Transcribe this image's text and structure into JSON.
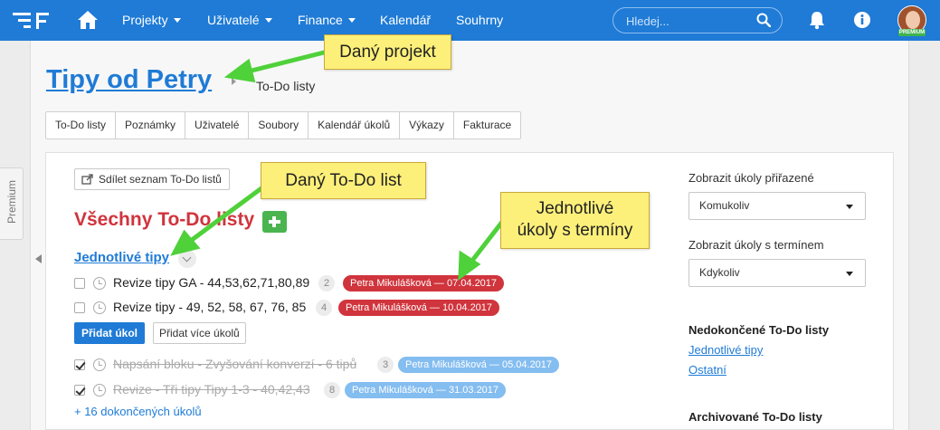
{
  "nav": {
    "items": [
      "Projekty",
      "Uživatelé",
      "Finance",
      "Kalendář",
      "Souhrny"
    ],
    "search_placeholder": "Hledej...",
    "avatar_badge": "PREMIUM"
  },
  "sidebar_tab": "Premium",
  "project": {
    "title": "Tipy od Petry",
    "breadcrumb": "To-Do listy"
  },
  "tabs": [
    "To-Do listy",
    "Poznámky",
    "Uživatelé",
    "Soubory",
    "Kalendář úkolů",
    "Výkazy",
    "Fakturace"
  ],
  "share_button": "Sdílet seznam To-Do listů",
  "section_title": "Všechny To-Do listy",
  "todo_list": {
    "title": "Jednotlivé tipy",
    "open_tasks": [
      {
        "name": "Revize tipy GA - 44,53,62,71,80,89",
        "count": "2",
        "tag": "Petra Mikulášková — 07.04.2017"
      },
      {
        "name": "Revize tipy - 49, 52, 58, 67, 76, 85",
        "count": "4",
        "tag": "Petra Mikulášková — 10.04.2017"
      }
    ],
    "add_task_button": "Přidat úkol",
    "add_more_button": "Přidat více úkolů",
    "done_tasks": [
      {
        "name": "Napsání bloku - Zvyšování konverzí - 6 tipů",
        "count": "3",
        "tag": "Petra Mikulášková — 05.04.2017"
      },
      {
        "name": "Revize - Tři tipy Tipy 1-3 - 40,42,43",
        "count": "8",
        "tag": "Petra Mikulášková — 31.03.2017"
      }
    ],
    "done_link": "+ 16 dokončených úkolů"
  },
  "right_panel": {
    "assigned_label": "Zobrazit úkoly přiřazené",
    "assigned_value": "Komukoliv",
    "deadline_label": "Zobrazit úkoly s termínem",
    "deadline_value": "Kdykoliv",
    "unfinished_heading": "Nedokončené To-Do listy",
    "unfinished_links": [
      "Jednotlivé tipy",
      "Ostatní"
    ],
    "archived_heading": "Archivované To-Do listy"
  },
  "callouts": {
    "project": "Daný projekt",
    "todo_list": "Daný To-Do list",
    "tasks_line1": "Jednotlivé",
    "tasks_line2": "úkoly s termíny"
  },
  "colors": {
    "brand": "#1f7bd6",
    "title_red": "#d0343c",
    "add_green": "#4ab44f",
    "tag_done": "#84bdf0",
    "callout_bg": "#fdf07a",
    "arrow_green": "#4fd13a"
  }
}
